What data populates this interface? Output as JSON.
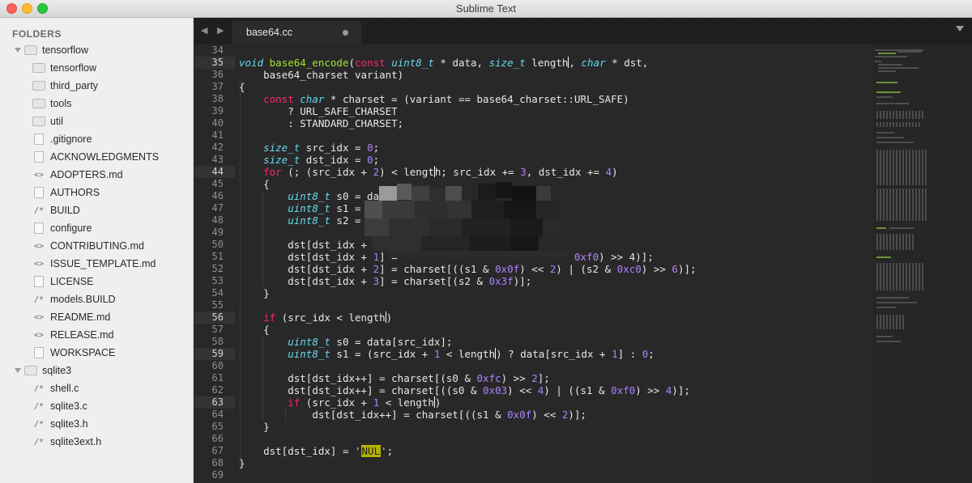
{
  "window": {
    "title": "Sublime Text"
  },
  "sidebar": {
    "header": "FOLDERS",
    "items": [
      {
        "label": "tensorflow",
        "icon": "folder-open-icon"
      },
      {
        "label": "tensorflow",
        "icon": "folder-icon"
      },
      {
        "label": "third_party",
        "icon": "folder-icon"
      },
      {
        "label": "tools",
        "icon": "folder-icon"
      },
      {
        "label": "util",
        "icon": "folder-icon"
      },
      {
        "label": ".gitignore",
        "icon": "file-icon"
      },
      {
        "label": "ACKNOWLEDGMENTS",
        "icon": "file-icon"
      },
      {
        "label": "ADOPTERS.md",
        "icon": "code-file-icon"
      },
      {
        "label": "AUTHORS",
        "icon": "file-icon"
      },
      {
        "label": "BUILD",
        "icon": "comment-file-icon"
      },
      {
        "label": "configure",
        "icon": "file-icon"
      },
      {
        "label": "CONTRIBUTING.md",
        "icon": "code-file-icon"
      },
      {
        "label": "ISSUE_TEMPLATE.md",
        "icon": "code-file-icon"
      },
      {
        "label": "LICENSE",
        "icon": "file-icon"
      },
      {
        "label": "models.BUILD",
        "icon": "comment-file-icon"
      },
      {
        "label": "README.md",
        "icon": "code-file-icon"
      },
      {
        "label": "RELEASE.md",
        "icon": "code-file-icon"
      },
      {
        "label": "WORKSPACE",
        "icon": "file-icon"
      },
      {
        "label": "sqlite3",
        "icon": "folder-open-icon"
      },
      {
        "label": "shell.c",
        "icon": "comment-file-icon"
      },
      {
        "label": "sqlite3.c",
        "icon": "comment-file-icon"
      },
      {
        "label": "sqlite3.h",
        "icon": "comment-file-icon"
      },
      {
        "label": "sqlite3ext.h",
        "icon": "comment-file-icon"
      }
    ]
  },
  "tabbar": {
    "nav": "◀ ▶",
    "active_tab": "base64.cc"
  },
  "editor": {
    "line_numbers": [
      "34",
      "35",
      "36",
      "37",
      "38",
      "39",
      "40",
      "41",
      "42",
      "43",
      "44",
      "45",
      "46",
      "47",
      "48",
      "49",
      "50",
      "51",
      "52",
      "53",
      "54",
      "55",
      "56",
      "57",
      "58",
      "59",
      "60",
      "61",
      "62",
      "63",
      "64",
      "65",
      "66",
      "67",
      "68",
      "69"
    ],
    "code": {
      "l35_void": "void",
      "l35_fn": "base64_encode",
      "l35_const": "const",
      "l35_t1": "uint8_t",
      "l35_a": " * data, ",
      "l35_t2": "size_t",
      "l35_b": " length",
      "l35_c": ", ",
      "l35_t3": "char",
      "l35_d": " * dst,",
      "l36": "    base64_charset variant)",
      "l37": "{",
      "l38_const": "const",
      "l38_char": "char",
      "l38_rest": " * charset = (variant == base64_charset::URL_SAFE)",
      "l39": "        ? URL_SAFE_CHARSET",
      "l40": "        : STANDARD_CHARSET;",
      "l42_t": "size_t",
      "l42_r": " src_idx = ",
      "l42_n": "0",
      "l42_e": ";",
      "l43_t": "size_t",
      "l43_r": " dst_idx = ",
      "l43_n": "0",
      "l43_e": ";",
      "l44_for": "for",
      "l44_a": " (; (src_idx + ",
      "l44_n1": "2",
      "l44_b": ") < lengt",
      "l44_c": "h; src_idx += ",
      "l44_n2": "3",
      "l44_d": ", dst_idx += ",
      "l44_n3": "4",
      "l44_e": ")",
      "l45": "    {",
      "l46_t": "uint8_t",
      "l46_r": " s0 = data",
      "l47_t": "uint8_t",
      "l47_r": " s1 = d",
      "l48_t": "uint8_t",
      "l48_r": " s2 = d",
      "l50_a": "dst[dst_idx + ",
      "l50_n": "0",
      "l50_b": "]",
      "l51_a": "dst[dst_idx + ",
      "l51_n": "1",
      "l51_b": "] = ",
      "l51_tail": "0xf0",
      "l51_end": ") >> 4)];",
      "l52_a": "dst[dst_idx + ",
      "l52_n": "2",
      "l52_b": "] = charset[((s1 & ",
      "l52_h1": "0x0f",
      "l52_c": ") << ",
      "l52_n2": "2",
      "l52_d": ") | (s2 & ",
      "l52_h2": "0xc0",
      "l52_e": ") >> ",
      "l52_n3": "6",
      "l52_f": ")];",
      "l53_a": "dst[dst_idx + ",
      "l53_n": "3",
      "l53_b": "] = charset[(s2 & ",
      "l53_h": "0x3f",
      "l53_c": ")];",
      "l54": "    }",
      "l56_if": "if",
      "l56_r": " (src_idx < length",
      "l56_e": ")",
      "l57": "    {",
      "l58_t": "uint8_t",
      "l58_r": " s0 = data[src_idx];",
      "l59_t": "uint8_t",
      "l59_a": " s1 = (src_idx + ",
      "l59_n": "1",
      "l59_b": " < length",
      "l59_c": ") ? data[src_idx + ",
      "l59_n2": "1",
      "l59_d": "] : ",
      "l59_n3": "0",
      "l59_e": ";",
      "l61_a": "dst[dst_idx++] = charset[(s0 & ",
      "l61_h": "0xfc",
      "l61_b": ") >> ",
      "l61_n": "2",
      "l61_c": "];",
      "l62_a": "dst[dst_idx++] = charset[((s0 & ",
      "l62_h": "0x03",
      "l62_b": ") << ",
      "l62_n": "4",
      "l62_c": ") | ((s1 & ",
      "l62_h2": "0xf0",
      "l62_d": ") >> ",
      "l62_n2": "4",
      "l62_e": ")];",
      "l63_if": "if",
      "l63_a": " (src_idx + ",
      "l63_n": "1",
      "l63_b": " < length",
      "l63_e": ")",
      "l64_a": "dst[dst_idx++] = charset[((s1 & ",
      "l64_h": "0x0f",
      "l64_b": ") << ",
      "l64_n": "2",
      "l64_c": ")];",
      "l65": "    }",
      "l67_a": "dst[dst_idx] = ",
      "l67_q1": "'",
      "l67_s": "NUL",
      "l67_q2": "'",
      "l67_e": ";",
      "l68": "}"
    }
  },
  "colors": {
    "keyword": "#f92672",
    "type": "#66d9ef",
    "function": "#a6e22e",
    "number": "#ae81ff",
    "string": "#e6db74",
    "background": "#282828",
    "sidebar": "#efefef"
  }
}
